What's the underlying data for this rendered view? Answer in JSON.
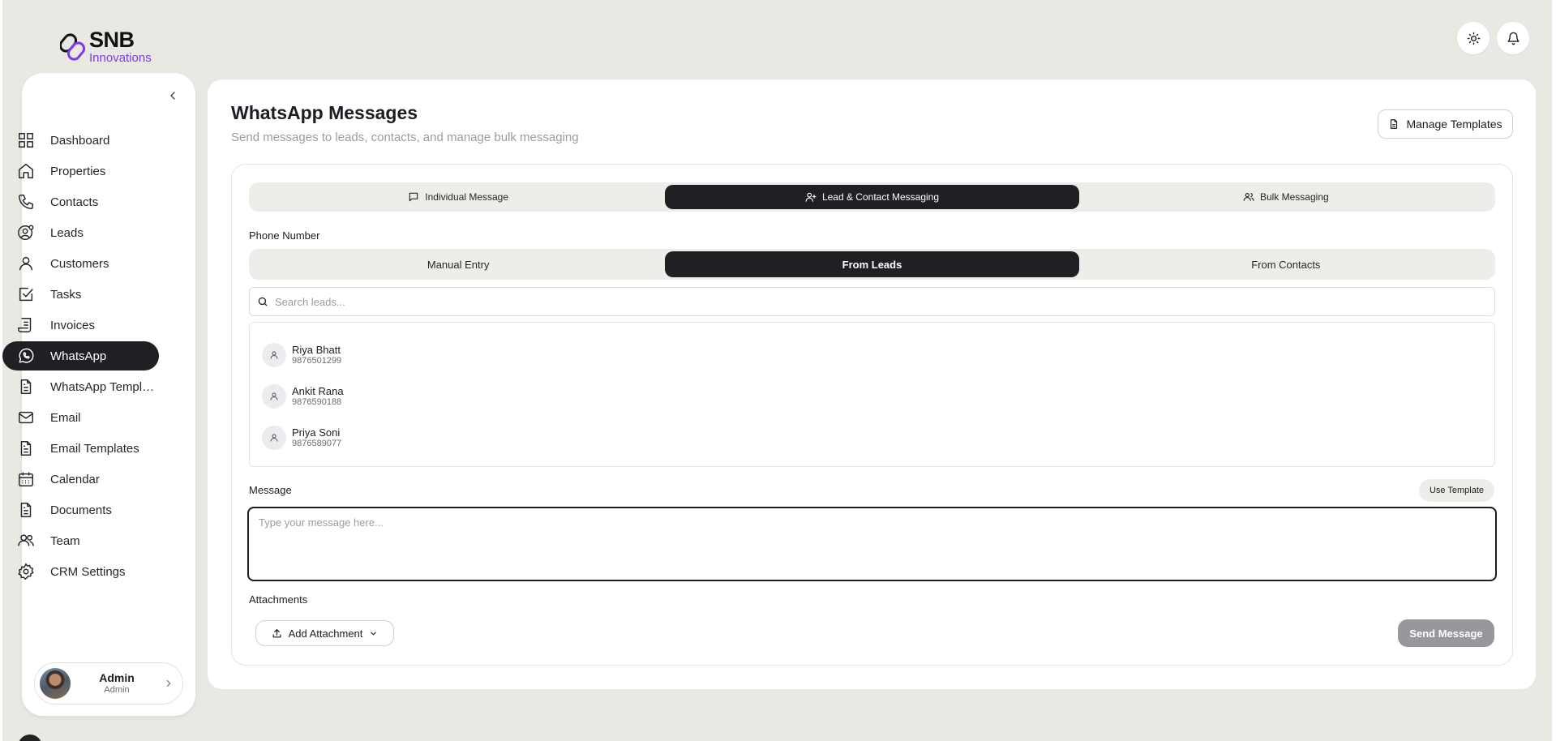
{
  "brand": {
    "name": "SNB",
    "tagline": "Innovations",
    "accent": "#7c3aed"
  },
  "header": {
    "theme_icon": "sun-icon",
    "notification_icon": "bell-icon"
  },
  "sidebar": {
    "collapse_icon": "chevron-left-icon",
    "items": [
      {
        "label": "Dashboard",
        "icon": "grid-icon"
      },
      {
        "label": "Properties",
        "icon": "home-icon"
      },
      {
        "label": "Contacts",
        "icon": "phone-icon"
      },
      {
        "label": "Leads",
        "icon": "user-target-icon"
      },
      {
        "label": "Customers",
        "icon": "user-icon"
      },
      {
        "label": "Tasks",
        "icon": "check-square-icon"
      },
      {
        "label": "Invoices",
        "icon": "receipt-icon"
      },
      {
        "label": "WhatsApp",
        "icon": "whatsapp-icon",
        "active": true
      },
      {
        "label": "WhatsApp Templates",
        "icon": "file-text-icon"
      },
      {
        "label": "Email",
        "icon": "mail-icon"
      },
      {
        "label": "Email Templates",
        "icon": "file-text-icon"
      },
      {
        "label": "Calendar",
        "icon": "calendar-icon"
      },
      {
        "label": "Documents",
        "icon": "file-text-icon"
      },
      {
        "label": "Team",
        "icon": "users-icon"
      },
      {
        "label": "CRM Settings",
        "icon": "gear-icon"
      }
    ],
    "user": {
      "name": "Admin",
      "role": "Admin"
    }
  },
  "page": {
    "title": "WhatsApp Messages",
    "subtitle": "Send messages to leads, contacts, and manage bulk messaging",
    "manage_templates_label": "Manage Templates"
  },
  "tabs": [
    {
      "label": "Individual Message",
      "icon": "message-square-icon"
    },
    {
      "label": "Lead & Contact Messaging",
      "icon": "user-plus-icon",
      "active": true
    },
    {
      "label": "Bulk Messaging",
      "icon": "users-icon"
    }
  ],
  "phone": {
    "label": "Phone Number",
    "sources": [
      {
        "label": "Manual Entry"
      },
      {
        "label": "From Leads",
        "active": true
      },
      {
        "label": "From Contacts"
      }
    ],
    "search_placeholder": "Search leads...",
    "leads": [
      {
        "name": "Riya Bhatt",
        "phone": "9876501299"
      },
      {
        "name": "Ankit Rana",
        "phone": "9876590188"
      },
      {
        "name": "Priya Soni",
        "phone": "9876589077"
      }
    ]
  },
  "message": {
    "label": "Message",
    "use_template_label": "Use Template",
    "placeholder": "Type your message here..."
  },
  "attachments": {
    "label": "Attachments",
    "add_label": "Add Attachment"
  },
  "send_label": "Send Message",
  "colors": {
    "dark": "#202024",
    "muted_bg": "#eeede9",
    "page_bg": "#e9e8e3",
    "send_disabled": "#98989c"
  }
}
